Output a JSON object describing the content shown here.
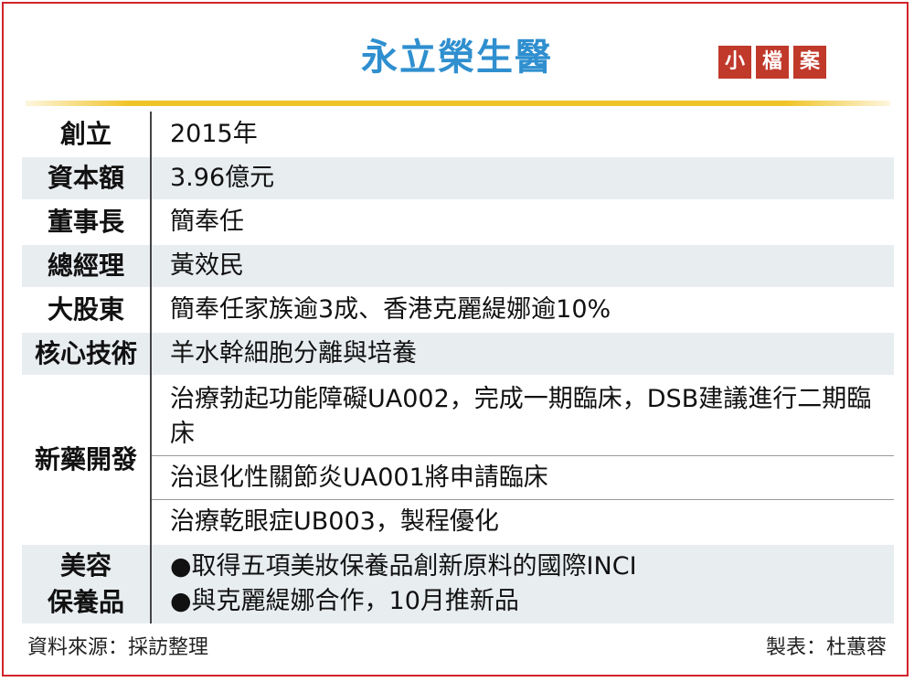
{
  "title": "永立榮生醫",
  "tag": [
    "小",
    "檔",
    "案"
  ],
  "rows": {
    "founded": {
      "label": "創立",
      "value": "2015年"
    },
    "capital": {
      "label": "資本額",
      "value": "3.96億元"
    },
    "chairman": {
      "label": "董事長",
      "value": "簡奉任"
    },
    "gm": {
      "label": "總經理",
      "value": "黃效民"
    },
    "shareholder": {
      "label": "大股東",
      "value": "簡奉任家族逾3成、香港克麗緹娜逾10%"
    },
    "tech": {
      "label": "核心技術",
      "value": "羊水幹細胞分離與培養"
    },
    "newdrug": {
      "label": "新藥開發",
      "items": [
        "治療勃起功能障礙UA002，完成一期臨床，DSB建議進行二期臨床",
        "治退化性關節炎UA001將申請臨床",
        "治療乾眼症UB003，製程優化"
      ]
    },
    "beauty": {
      "label_line1": "美容",
      "label_line2": "保養品",
      "items": [
        "●取得五項美妝保養品創新原料的國際INCI",
        "●與克麗緹娜合作，10月推新品"
      ]
    }
  },
  "footer": {
    "source": "資料來源：採訪整理",
    "maker": "製表：杜蕙蓉"
  }
}
